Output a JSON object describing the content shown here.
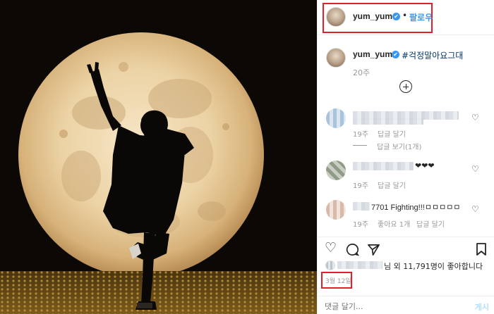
{
  "header": {
    "username": "yum_yum",
    "verified_glyph": "✔",
    "separator": "•",
    "follow_label": "팔로우",
    "highlight_color": "#e0212b"
  },
  "caption": {
    "username": "yum_yum",
    "hashtag": "#걱정말아요그대",
    "time": "20주"
  },
  "comments": [
    {
      "text": "",
      "time": "19주",
      "reply_label": "답글 달기",
      "view_replies": "답글 보기(1개)"
    },
    {
      "text": "❤❤❤",
      "time": "19주",
      "reply_label": "답글 달기"
    },
    {
      "text": "7701 Fighting!!!ㅁㅁㅁㅁㅁ",
      "time": "19주",
      "likes_label": "좋아요 1개",
      "reply_label": "답글 달기"
    }
  ],
  "actions": {
    "like_icon": "heart-outline",
    "comment_icon": "speech-bubble",
    "share_icon": "share-arrow",
    "save_icon": "bookmark"
  },
  "likes_text": "님 외 11,791명이 좋아합니다",
  "date": "3월 12일",
  "comment_box": {
    "placeholder": "댓글 달기...",
    "post_label": "게시"
  },
  "colors": {
    "accent": "#3897f0",
    "link": "#003569",
    "muted": "#999999"
  }
}
